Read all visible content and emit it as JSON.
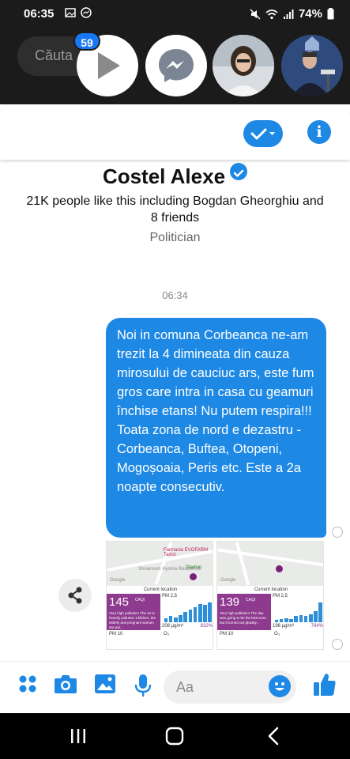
{
  "status_bar": {
    "time": "06:35",
    "battery": "74%"
  },
  "chat_heads": {
    "search_placeholder": "Căuta",
    "badge_count": "59"
  },
  "page_profile": {
    "name": "Costel Alexe",
    "likes_text": "21K people like this including Bogdan Gheorghiu and 8 friends",
    "category": "Politician"
  },
  "conversation": {
    "timestamp": "06:34",
    "message": "Noi in comuna Corbeanca ne-am trezit la 4 dimineata din cauza mirosului de cauciuc ars, este fum gros care intra in casa cu geamuri închise etans! Nu putem respira!!! Toata zona de nord e dezastru - Corbeanca, Buftea, Otopeni, Mogoșoaia, Peris etc. Este a 2a noapte consecutiv."
  },
  "attachments": [
    {
      "map_labels": [
        "Farmacia EVOFARM Tamsi",
        "Showroom Hystria Residence",
        "Stadion",
        "Google"
      ],
      "location_label": "Current location",
      "aqi": "145",
      "aqi_unit": "CAQI",
      "aqi_desc": "Very high pollution! The air is heavily polluted. Children, the elderly and pregnant women are par...",
      "pm_label": "PM 2,5",
      "pm_value": "208 µg/m³",
      "pm_pct": "832%",
      "pm10_label": "PM 10",
      "o3_label": "O₃",
      "bars": [
        0.2,
        0.3,
        0.25,
        0.35,
        0.5,
        0.6,
        0.75,
        0.9,
        0.85,
        0.95
      ]
    },
    {
      "map_labels": [
        "Google"
      ],
      "location_label": "Current location",
      "aqi": "139",
      "aqi_unit": "CAQI",
      "aqi_desc": "Very high pollution! The day was going to be the best ever, but it turned out ghastly...",
      "pm_label": "PM 2,5",
      "pm_value": "196 µg/m³",
      "pm_pct": "784%",
      "pm10_label": "PM 10",
      "o3_label": "O₃",
      "bars": [
        0.1,
        0.15,
        0.2,
        0.15,
        0.3,
        0.35,
        0.3,
        0.4,
        0.55,
        0.95
      ]
    }
  ],
  "composer": {
    "placeholder": "Aa"
  },
  "colors": {
    "accent": "#1e88e5",
    "aqi_purple": "#8e3a8e",
    "dark_bg": "#1b1b1b"
  }
}
